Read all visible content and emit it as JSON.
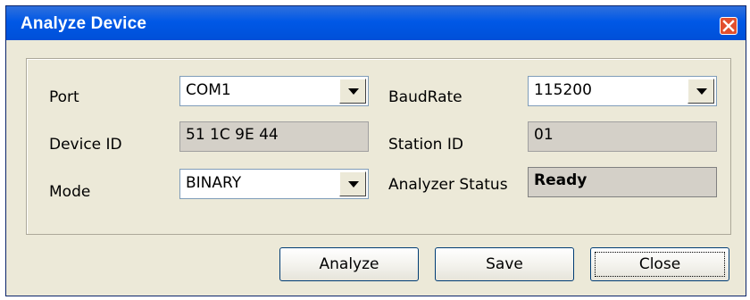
{
  "window": {
    "title": "Analyze Device",
    "close_icon": "close-icon"
  },
  "fields": {
    "port": {
      "label": "Port",
      "value": "COM1"
    },
    "baudrate": {
      "label": "BaudRate",
      "value": "115200"
    },
    "device_id": {
      "label": "Device ID",
      "value": "51 1C 9E 44"
    },
    "station_id": {
      "label": "Station ID",
      "value": "01"
    },
    "mode": {
      "label": "Mode",
      "value": "BINARY"
    },
    "analyzer_status": {
      "label": "Analyzer Status",
      "value": "Ready"
    }
  },
  "buttons": {
    "analyze": "Analyze",
    "save": "Save",
    "close": "Close"
  },
  "colors": {
    "titlebar": "#0058e6",
    "window_bg": "#ece9d8",
    "close_red": "#e24f2e"
  }
}
